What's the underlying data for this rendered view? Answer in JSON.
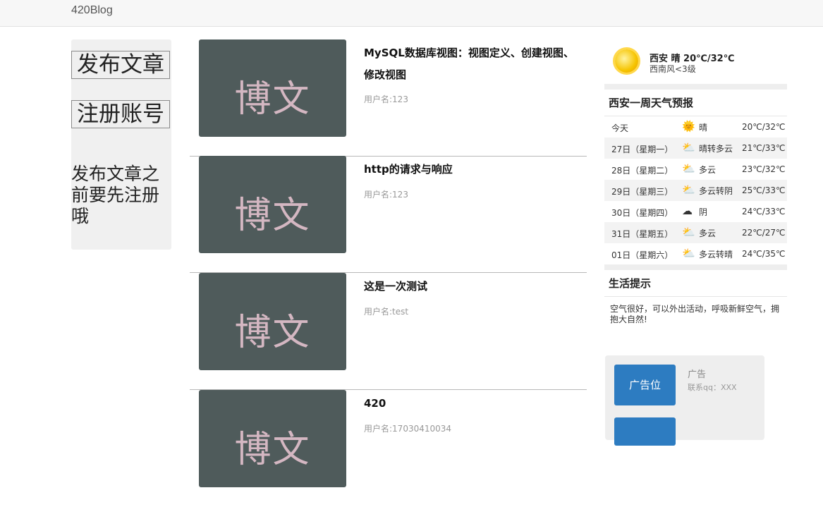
{
  "header": {
    "brand": "420Blog"
  },
  "left_panel": {
    "publish_label": "发布文章",
    "register_label": "注册账号",
    "note": "发布文章之前要先注册哦"
  },
  "posts": [
    {
      "thumb_text": "博文",
      "title": "MySQL数据库视图：视图定义、创建视图、修改视图",
      "user": "用户名:123"
    },
    {
      "thumb_text": "博文",
      "title": "http的请求与响应",
      "user": "用户名:123"
    },
    {
      "thumb_text": "博文",
      "title": "这是一次测试",
      "user": "用户名:test"
    },
    {
      "thumb_text": "博文",
      "title": "420",
      "user": "用户名:17030410034"
    }
  ],
  "weather": {
    "current": "西安 晴 20℃/32℃",
    "wind": "西南风<3级",
    "forecast_title": "西安一周天气预报",
    "forecast": [
      {
        "day": "今天",
        "icon": "sun-icon",
        "cond": "晴",
        "temp": "20℃/32℃"
      },
      {
        "day": "27日（星期一）",
        "icon": "partly-cloudy-icon",
        "cond": "晴转多云",
        "temp": "21℃/33℃"
      },
      {
        "day": "28日（星期二）",
        "icon": "partly-cloudy-icon",
        "cond": "多云",
        "temp": "23℃/32℃"
      },
      {
        "day": "29日（星期三）",
        "icon": "partly-cloudy-icon",
        "cond": "多云转阴",
        "temp": "25℃/33℃"
      },
      {
        "day": "30日（星期四）",
        "icon": "cloud-icon",
        "cond": "阴",
        "temp": "24℃/33℃"
      },
      {
        "day": "31日（星期五）",
        "icon": "partly-cloudy-icon",
        "cond": "多云",
        "temp": "22℃/27℃"
      },
      {
        "day": "01日（星期六）",
        "icon": "partly-cloudy-icon",
        "cond": "多云转晴",
        "temp": "24℃/35℃"
      }
    ],
    "tips_title": "生活提示",
    "tips": "空气很好，可以外出活动，呼吸新鲜空气，拥抱大自然!"
  },
  "ad": {
    "button_label": "广告位",
    "title": "广告",
    "contact": "联系qq：XXX",
    "accent": "#2d7cc1"
  }
}
